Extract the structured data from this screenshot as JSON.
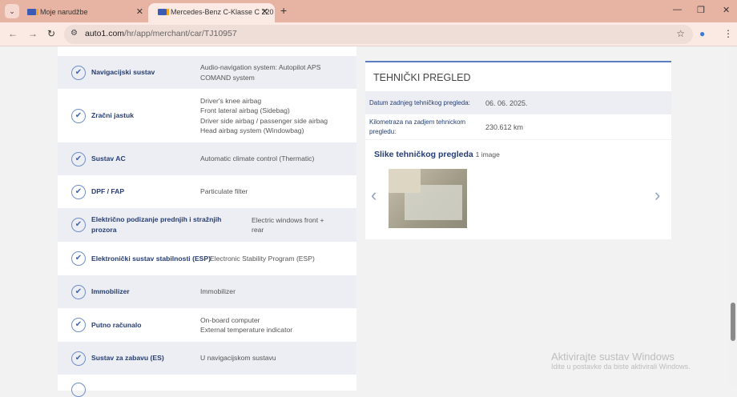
{
  "browser": {
    "tabs": [
      {
        "label": "Moje narudžbe"
      },
      {
        "label": "Mercedes-Benz C-Klasse C 220"
      }
    ],
    "url_host": "auto1.com",
    "url_path": "/hr/app/merchant/car/TJ10957"
  },
  "equipment": [
    {
      "label": "Navigacijski sustav",
      "value": [
        "Audio-navigation system: Autopilot APS",
        "COMAND system"
      ]
    },
    {
      "label": "Zračni jastuk",
      "value": [
        "Driver's knee airbag",
        "Front lateral airbag (Sidebag)",
        "Driver side airbag / passenger side airbag",
        "Head airbag system (Windowbag)"
      ]
    },
    {
      "label": "Sustav AC",
      "value": [
        "Automatic climate control (Thermatic)"
      ]
    },
    {
      "label": "DPF / FAP",
      "value": [
        "Particulate filter"
      ]
    },
    {
      "label": "Električno podizanje prednjih i stražnjih prozora",
      "value": [
        "Electric windows front +",
        "rear"
      ]
    },
    {
      "label": "Elektronički sustav stabilnosti (ESP)",
      "value": [
        "Electronic Stability Program (ESP)"
      ]
    },
    {
      "label": "Immobilizer",
      "value": [
        "Immobilizer"
      ]
    },
    {
      "label": "Putno računalo",
      "value": [
        "On-board computer",
        "External temperature indicator"
      ]
    },
    {
      "label": "Sustav za zabavu (ES)",
      "value": [
        "U navigacijskom sustavu"
      ]
    }
  ],
  "inspection": {
    "title": "TEHNIČKI PREGLED",
    "rows": [
      {
        "key": "Datum zadnjeg tehničkog pregleda:",
        "value": "06. 06. 2025."
      },
      {
        "key": "Kilometraza na zadjem tehnickom pregledu:",
        "value": "230.612 km"
      }
    ],
    "gallery_title": "Slike tehničkog pregleda",
    "gallery_count": "1 image"
  },
  "watermark": {
    "line1": "Aktivirajte sustav Windows",
    "line2": "Idite u postavke da biste aktivirali Windows."
  }
}
